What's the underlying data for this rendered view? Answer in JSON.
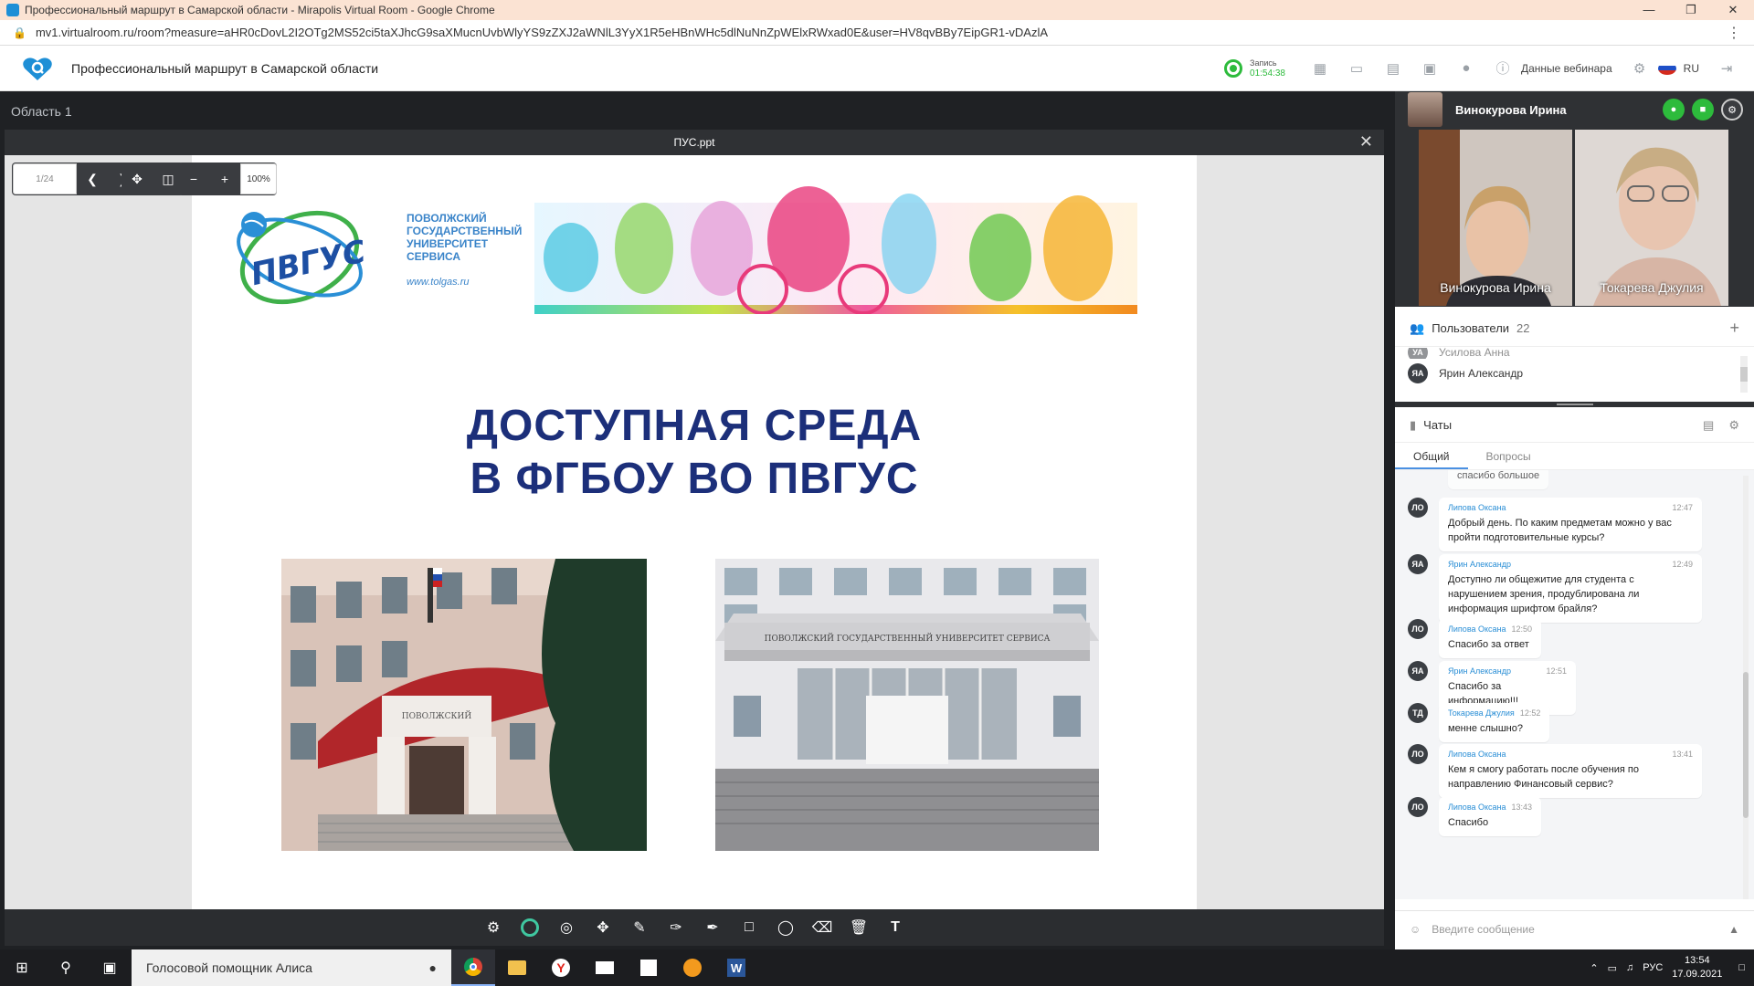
{
  "browser": {
    "window_title": "Профессиональный маршрут в Самарской области - Mirapolis Virtual Room - Google Chrome",
    "url": "mv1.virtualroom.ru/room?measure=aHR0cDovL2I2OTg2MS52ci5taXJhcG9saXMucnUvbWlyYS9zZXJ2aWNlL3YyX1R5eHBnWHc5dlNuNnZpWElxRWxad0E&user=HV8qvBBy7EipGR1-vDAzlA"
  },
  "header": {
    "room_title": "Профессиональный маршрут в Самарской области",
    "record_label": "Запись",
    "record_time": "01:54:38",
    "webinar_data": "Данные вебинара",
    "language": "RU"
  },
  "area": {
    "title": "Область 1",
    "document_name": "ПУС.ppt",
    "page_indicator": "1/24",
    "zoom": "100%"
  },
  "slide": {
    "uni_line1": "ПОВОЛЖСКИЙ",
    "uni_line2": "ГОСУДАРСТВЕННЫЙ",
    "uni_line3": "УНИВЕРСИТЕТ",
    "uni_line4": "СЕРВИСА",
    "uni_url": "www.tolgas.ru",
    "logo_text": "ПВГУС",
    "headline_1": "ДОСТУПНАЯ СРЕДА",
    "headline_2": "В ФГБОУ ВО ПВГУС",
    "photo2_sign": "ПОВОЛЖСКИЙ ГОСУДАРСТВЕННЫЙ УНИВЕРСИТЕТ СЕРВИСА"
  },
  "video": {
    "presenter": "Винокурова Ирина",
    "tile1_name": "Винокурова Ирина",
    "tile2_name": "Токарева Джулия"
  },
  "users": {
    "title": "Пользователи",
    "count": "22",
    "partial_name": "Усилова Анна",
    "partial_initials": "УА",
    "row_initials": "ЯА",
    "row_name": "Ярин Александр"
  },
  "chat": {
    "title": "Чаты",
    "tab_general": "Общий",
    "tab_questions": "Вопросы",
    "partial_text": "спасибо большое",
    "messages": [
      {
        "initials": "ЛО",
        "author": "Липова Оксана",
        "time": "12:47",
        "text": "Добрый день. По каким предметам можно у вас пройти подготовительные курсы?"
      },
      {
        "initials": "ЯА",
        "author": "Ярин Александр",
        "time": "12:49",
        "text": "Доступно ли общежитие для студента с нарушением зрения, продублирована ли информация шрифтом брайля?"
      },
      {
        "initials": "ЛО",
        "author": "Липова Оксана",
        "time": "12:50",
        "text": "Спасибо за ответ"
      },
      {
        "initials": "ЯА",
        "author": "Ярин Александр",
        "time": "12:51",
        "text": "Спасибо за информацию!!!"
      },
      {
        "initials": "ТД",
        "author": "Токарева Джулия",
        "time": "12:52",
        "text": "менне слышно?"
      },
      {
        "initials": "ЛО",
        "author": "Липова Оксана",
        "time": "13:41",
        "text": "Кем я смогу работать после обучения по направлению Финансовый сервис?"
      },
      {
        "initials": "ЛО",
        "author": "Липова Оксана",
        "time": "13:43",
        "text": "Спасибо"
      }
    ],
    "compose_placeholder": "Введите сообщение"
  },
  "taskbar": {
    "search_text": "Голосовой помощник Алиса",
    "lang": "РУС",
    "time": "13:54",
    "date": "17.09.2021"
  },
  "colors": {
    "accent": "#2b8fd6",
    "record_green": "#2dbb3c",
    "headline_blue": "#1c2f7a",
    "dark_bar": "#2f3134"
  }
}
